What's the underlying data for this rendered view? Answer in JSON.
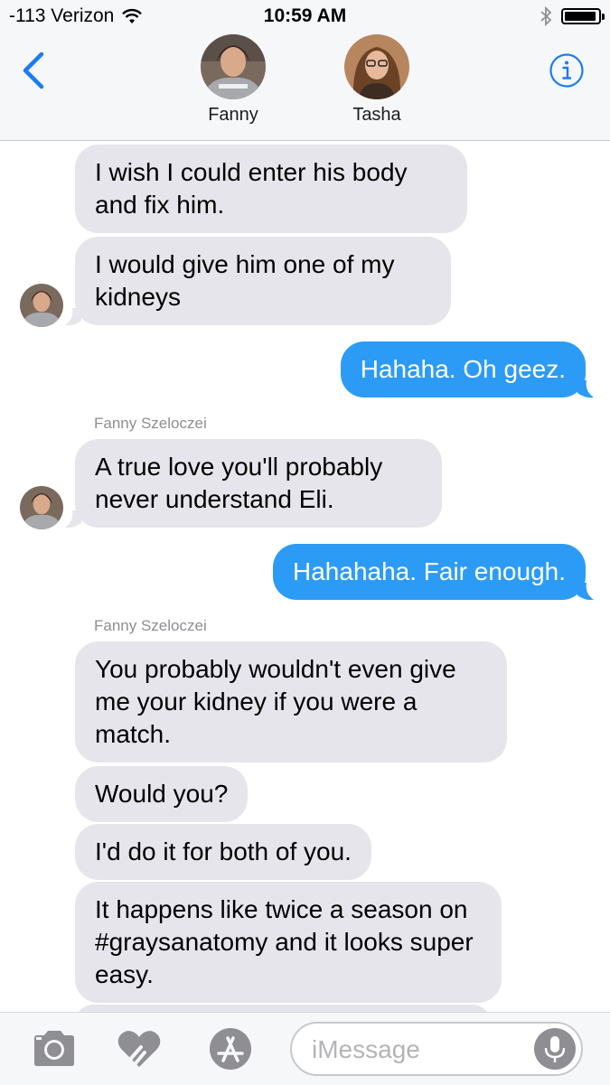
{
  "status": {
    "carrier": "-113 Verizon",
    "time": "10:59 AM",
    "battery_level": 0.95
  },
  "header": {
    "contacts": [
      {
        "name": "Fanny"
      },
      {
        "name": "Tasha"
      }
    ],
    "back_icon": "chevron-left-icon",
    "info_icon": "info-icon"
  },
  "messages": [
    {
      "dir": "in",
      "text": "I wish I could enter his body and fix him."
    },
    {
      "dir": "in",
      "text": "I would give him one of my kidneys"
    },
    {
      "dir": "out",
      "text": "Hahaha. Oh geez."
    },
    {
      "dir": "sender",
      "text": "Fanny Szeloczei"
    },
    {
      "dir": "in",
      "text": "A true love you'll probably never understand Eli."
    },
    {
      "dir": "out",
      "text": "Hahahaha. Fair enough."
    },
    {
      "dir": "sender",
      "text": "Fanny Szeloczei"
    },
    {
      "dir": "in",
      "text": "You probably wouldn't even give me your kidney if you were a match."
    },
    {
      "dir": "in",
      "text": "Would you?"
    },
    {
      "dir": "in",
      "text": "I'd do it for both of you."
    },
    {
      "dir": "in",
      "text": "It happens like twice a season on #graysanatomy and it looks super easy."
    }
  ],
  "input": {
    "placeholder": "iMessage",
    "value": ""
  },
  "colors": {
    "outgoing": "#2c9bf6",
    "incoming": "#e6e5eb",
    "accent": "#1a7cf2"
  }
}
